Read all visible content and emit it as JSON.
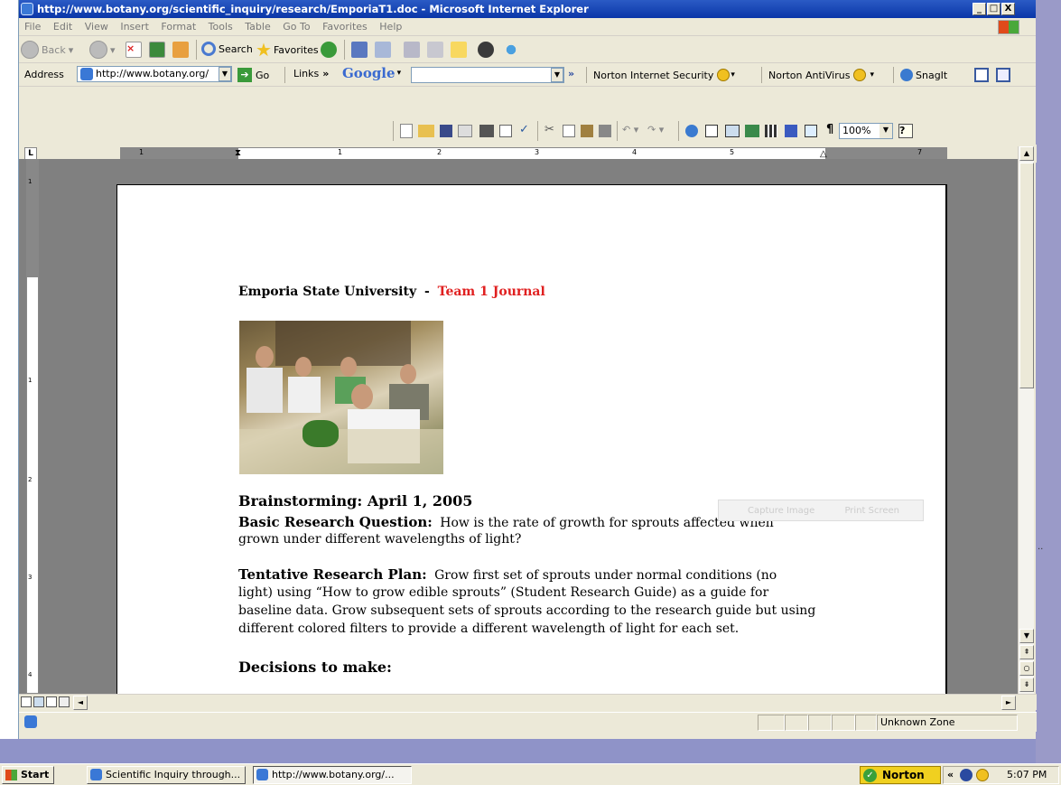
{
  "window": {
    "title": "http://www.botany.org/scientific_inquiry/research/EmporiaT1.doc - Microsoft Internet Explorer",
    "min": "_",
    "max": "□",
    "close": "X"
  },
  "menu": [
    "File",
    "Edit",
    "View",
    "Insert",
    "Format",
    "Tools",
    "Table",
    "Go To",
    "Favorites",
    "Help"
  ],
  "toolbar": {
    "back_label": "Back",
    "search_label": "Search",
    "favorites_label": "Favorites"
  },
  "addressbar": {
    "address_label": "Address",
    "address_value": "http://www.botany.org/",
    "go_label": "Go",
    "links_label": "Links",
    "links_chevron": "»",
    "google_label": "Google",
    "google_chevron": "»",
    "norton_security": "Norton Internet Security",
    "norton_antivirus": "Norton AntiVirus",
    "snagit_label": "SnagIt"
  },
  "word_toolbar": {
    "zoom_value": "100%",
    "pilcrow": "¶"
  },
  "ruler": {
    "tab_selector": "L",
    "marks": [
      "1",
      "1",
      "2",
      "3",
      "4",
      "5",
      "7"
    ],
    "vmarks": [
      "1",
      "1",
      "2",
      "3",
      "4"
    ]
  },
  "document": {
    "header_institution": "Emporia State University",
    "header_sep": "-",
    "header_journal": "Team 1 Journal",
    "brainstorm_heading": "Brainstorming:  April 1, 2005",
    "question_label": "Basic Research Question:",
    "question_line1": "How is the rate of growth for sprouts affected when",
    "question_line2": "grown under different wavelengths of light?",
    "plan_label": "Tentative Research Plan:",
    "plan_line1": "Grow first set of sprouts under normal conditions (no",
    "plan_line2": "light) using “How to grow edible sprouts” (Student Research Guide) as a guide for",
    "plan_line3": "baseline data.  Grow subsequent sets of sprouts according to the research guide but using",
    "plan_line4": "different colored filters to provide a different wavelength of light for each set.",
    "decisions_heading": "Decisions to make:"
  },
  "capture_popup": {
    "capture_label": "Capture Image",
    "print_label": "Print Screen"
  },
  "edge_ellipsis": "..",
  "statusbar": {
    "zone": "Unknown Zone"
  },
  "taskbar": {
    "start_label": "Start",
    "task1": "Scientific Inquiry through...",
    "task2": "http://www.botany.org/...",
    "norton_label": "Norton",
    "tray_chevron": "«",
    "clock": "5:07 PM"
  }
}
